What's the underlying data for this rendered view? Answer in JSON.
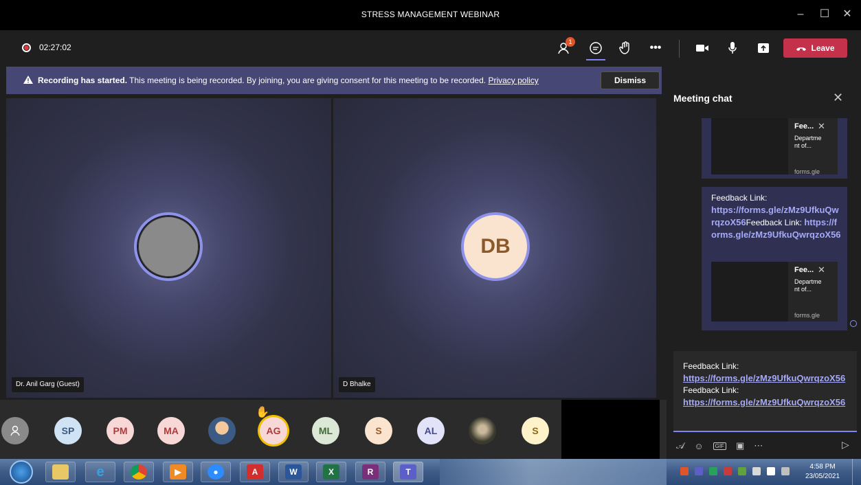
{
  "window": {
    "title": "STRESS MANAGEMENT WEBINAR"
  },
  "meeting": {
    "timer": "02:27:02",
    "participants_badge": "1",
    "leave_label": "Leave"
  },
  "banner": {
    "bold": "Recording has started.",
    "text": "This meeting is being recorded. By joining, you are giving consent for this meeting to be recorded.",
    "link": "Privacy policy",
    "dismiss": "Dismiss"
  },
  "videos": [
    {
      "name": "Dr. Anil Garg (Guest)",
      "initials": ""
    },
    {
      "name": "D Bhalke",
      "initials": "DB"
    }
  ],
  "participants": [
    {
      "initials": "",
      "bg": "#8a8a8a",
      "fg": "#ffffff"
    },
    {
      "initials": "SP",
      "bg": "#cfe3f5",
      "fg": "#3d5a80"
    },
    {
      "initials": "PM",
      "bg": "#f8d7d7",
      "fg": "#b03a3a"
    },
    {
      "initials": "MA",
      "bg": "#f8d7d7",
      "fg": "#b03a3a"
    },
    {
      "initials": "",
      "bg": "#3b5b85",
      "fg": "#ffffff"
    },
    {
      "initials": "AG",
      "bg": "#f8d7d7",
      "fg": "#b03a3a"
    },
    {
      "initials": "ML",
      "bg": "#dbe8d5",
      "fg": "#3f6b35"
    },
    {
      "initials": "S",
      "bg": "#fbe4cf",
      "fg": "#9a5b28"
    },
    {
      "initials": "AL",
      "bg": "#e2e3f8",
      "fg": "#444791"
    },
    {
      "initials": "",
      "bg": "#3b3a2e",
      "fg": "#ffffff"
    },
    {
      "initials": "S",
      "bg": "#fdf2c9",
      "fg": "#8a6a12"
    }
  ],
  "chat": {
    "title": "Meeting chat",
    "card_title": "Fee...",
    "card_sub": "Departme nt of...",
    "card_domain": "forms.gle",
    "msg_prefix1": "Feedback Link:",
    "msg_link_a": "https://forms.gle/zMz9UfkuQwrqzoX56",
    "msg_prefix2": "Feedback Link:",
    "msg_link_b": "https://forms.gle/zMz9UfkuQwrqzoX56",
    "compose_prefix1": "Feedback Link:",
    "compose_link_a": "https://forms.gle/zMz9UfkuQwrqzoX56",
    "compose_prefix2": "Feedback Link:",
    "compose_link_b": "https://forms.gle/zMz9UfkuQwrqzoX56"
  },
  "taskbar": {
    "time": "4:58 PM",
    "date": "23/05/2021"
  }
}
